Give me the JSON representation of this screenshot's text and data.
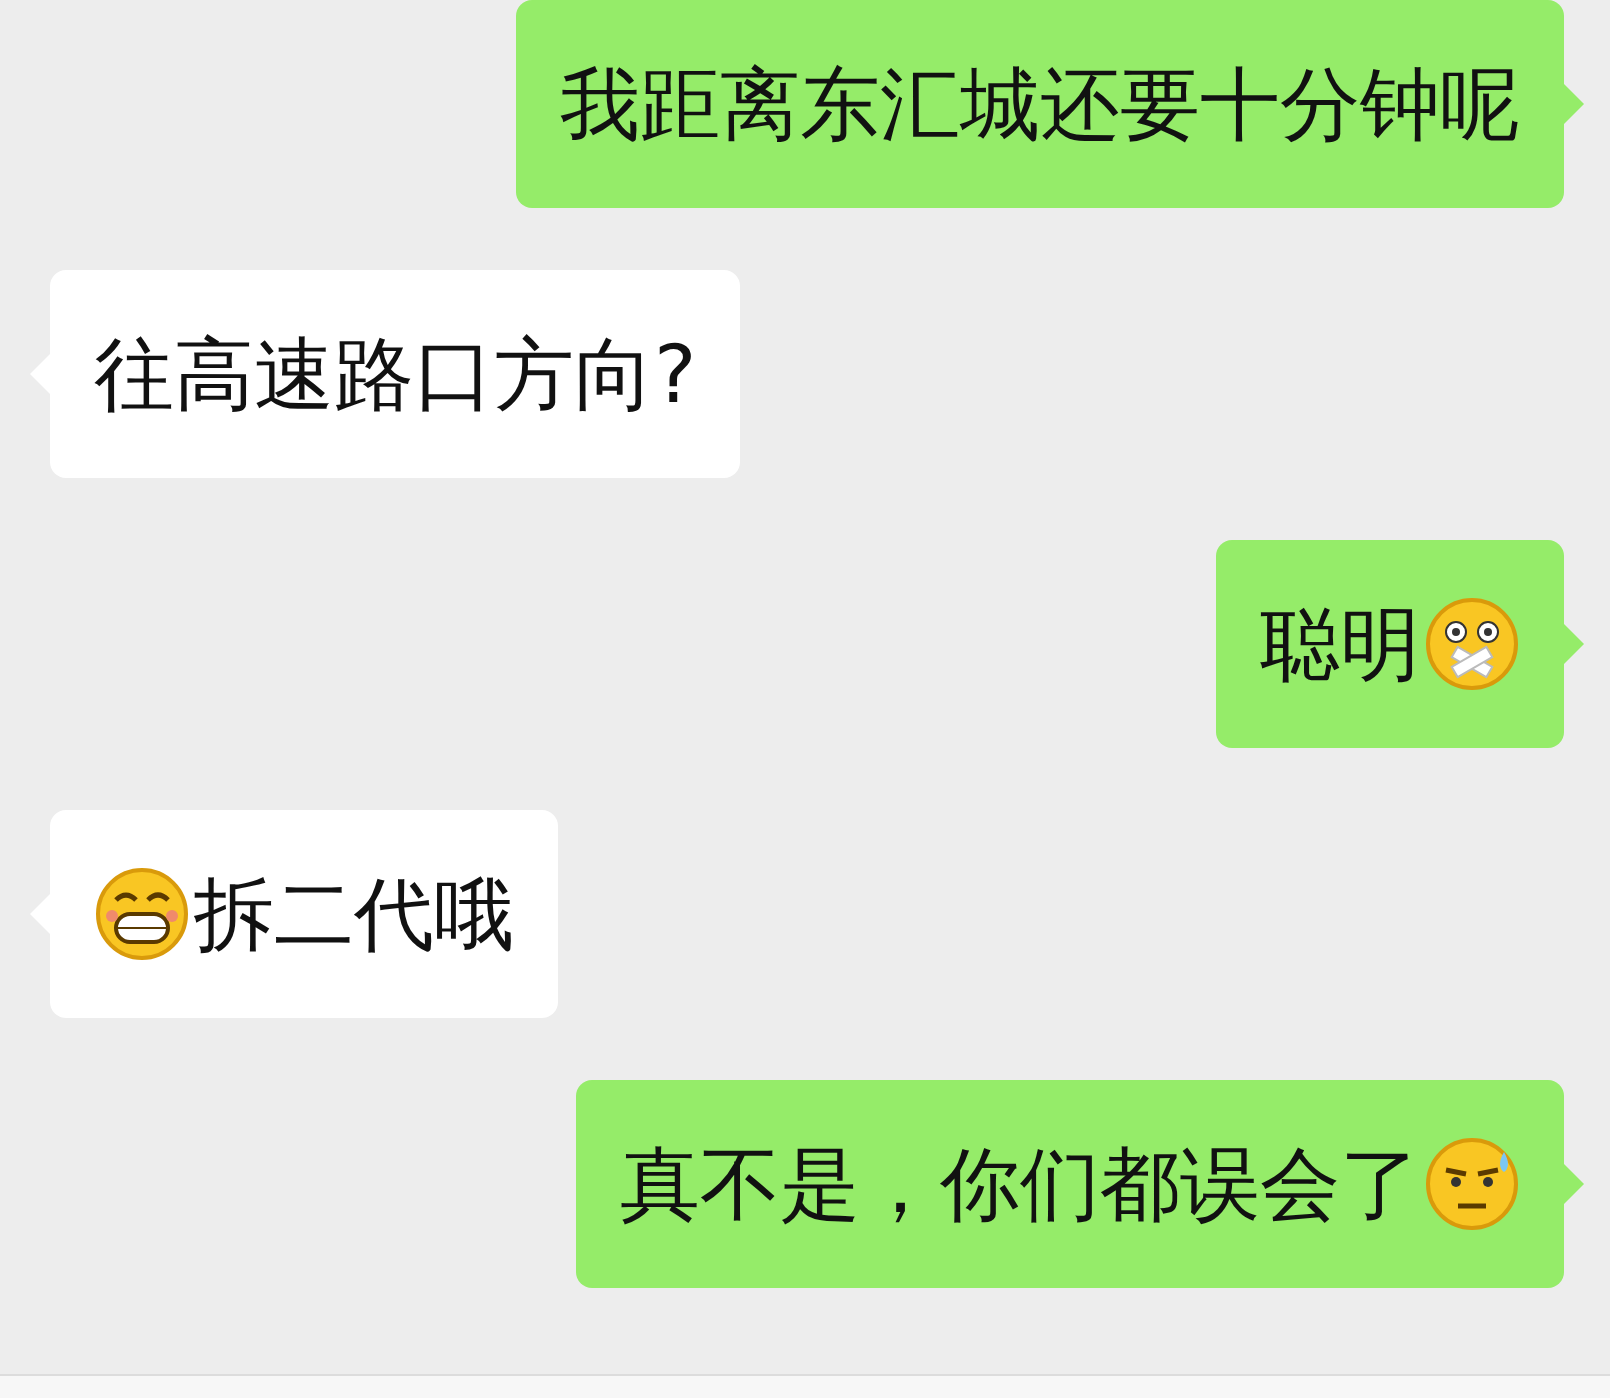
{
  "messages": [
    {
      "kind": "outgoing",
      "parts": [
        {
          "kind": "text",
          "text": "我距离东汇城还要十分钟呢"
        }
      ]
    },
    {
      "kind": "incoming",
      "parts": [
        {
          "kind": "text",
          "text": "往高速路口方向?"
        }
      ]
    },
    {
      "kind": "outgoing",
      "parts": [
        {
          "kind": "text",
          "text": "聪明"
        },
        {
          "kind": "emoji"
        }
      ]
    },
    {
      "kind": "incoming",
      "parts": [
        {
          "kind": "emoji"
        },
        {
          "kind": "text",
          "text": "拆二代哦"
        }
      ]
    },
    {
      "kind": "outgoing",
      "parts": [
        {
          "kind": "text",
          "text": "真不是，你们都误会了"
        },
        {
          "kind": "emoji"
        }
      ]
    }
  ]
}
